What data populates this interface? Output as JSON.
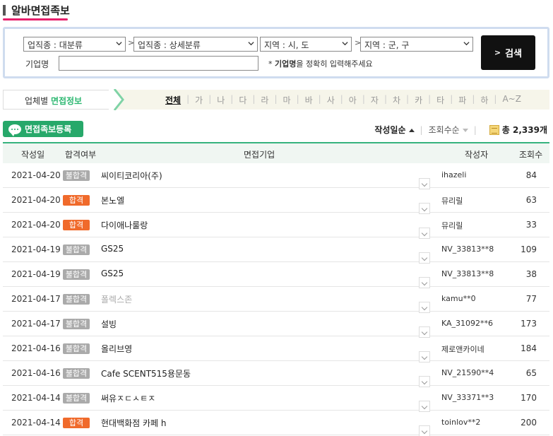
{
  "page_title": "알바면접족보",
  "search": {
    "selects": [
      {
        "label": "업직종 : 대분류"
      },
      {
        "label": "업직종 : 상세분류"
      },
      {
        "label": "지역 : 시, 도"
      },
      {
        "label": "지역 : 군, 구"
      }
    ],
    "separator": ">",
    "company_label": "기업명",
    "company_value": "",
    "hint_star": "* ",
    "hint_bold": "기업명",
    "hint_rest": "을 정확히 입력해주세요",
    "button_label": "검색",
    "button_chevron": ">"
  },
  "tabs": {
    "active_prefix": "업체별 ",
    "active_highlight": "면접정보",
    "letters": [
      "전체",
      "가",
      "나",
      "다",
      "라",
      "마",
      "바",
      "사",
      "아",
      "자",
      "차",
      "카",
      "타",
      "파",
      "하",
      "A~Z"
    ],
    "active_letter": "전체"
  },
  "toolbar": {
    "register_label": "면접족보등록",
    "sort_date": "작성일순",
    "sort_views": "조회수순",
    "total_prefix": "총 ",
    "total_count": "2,339개"
  },
  "table": {
    "headers": {
      "date": "작성일",
      "result": "합격여부",
      "company": "면접기업",
      "author": "작성자",
      "views": "조회수"
    },
    "rows": [
      {
        "date": "2021-04-20",
        "result": "불합격",
        "status": "fail",
        "company": "씨이티코리아(주)",
        "author": "ihazeli",
        "views": "84",
        "dim": false
      },
      {
        "date": "2021-04-20",
        "result": "합격",
        "status": "pass",
        "company": "본노엘",
        "author": "뮤리릴",
        "views": "63",
        "dim": false
      },
      {
        "date": "2021-04-20",
        "result": "합격",
        "status": "pass",
        "company": "다이애나룰랑",
        "author": "뮤리릴",
        "views": "33",
        "dim": false
      },
      {
        "date": "2021-04-19",
        "result": "불합격",
        "status": "fail",
        "company": "GS25",
        "author": "NV_33813**8",
        "views": "109",
        "dim": false
      },
      {
        "date": "2021-04-19",
        "result": "불합격",
        "status": "fail",
        "company": "GS25",
        "author": "NV_33813**8",
        "views": "38",
        "dim": false
      },
      {
        "date": "2021-04-17",
        "result": "불합격",
        "status": "fail",
        "company": "폴렉스존",
        "author": "kamu**0",
        "views": "77",
        "dim": true
      },
      {
        "date": "2021-04-17",
        "result": "불합격",
        "status": "fail",
        "company": "설빙",
        "author": "KA_31092**6",
        "views": "173",
        "dim": false
      },
      {
        "date": "2021-04-16",
        "result": "불합격",
        "status": "fail",
        "company": "올리브영",
        "author": "제로앤카이네",
        "views": "184",
        "dim": false
      },
      {
        "date": "2021-04-16",
        "result": "불합격",
        "status": "fail",
        "company": "Cafe SCENT515용문동",
        "author": "NV_21590**4",
        "views": "65",
        "dim": false
      },
      {
        "date": "2021-04-14",
        "result": "불합격",
        "status": "fail",
        "company": "써유ㅈㄷㅅㅌㅈ",
        "author": "NV_33371**3",
        "views": "170",
        "dim": false
      },
      {
        "date": "2021-04-14",
        "result": "합격",
        "status": "pass",
        "company": "현대백화점 카페 h",
        "author": "toinlov**2",
        "views": "200",
        "dim": false
      }
    ]
  },
  "colors": {
    "accent": "#2eb872",
    "pass": "#f06a2b",
    "fail": "#aaaaaa",
    "title_underline": "#e61f6b"
  }
}
